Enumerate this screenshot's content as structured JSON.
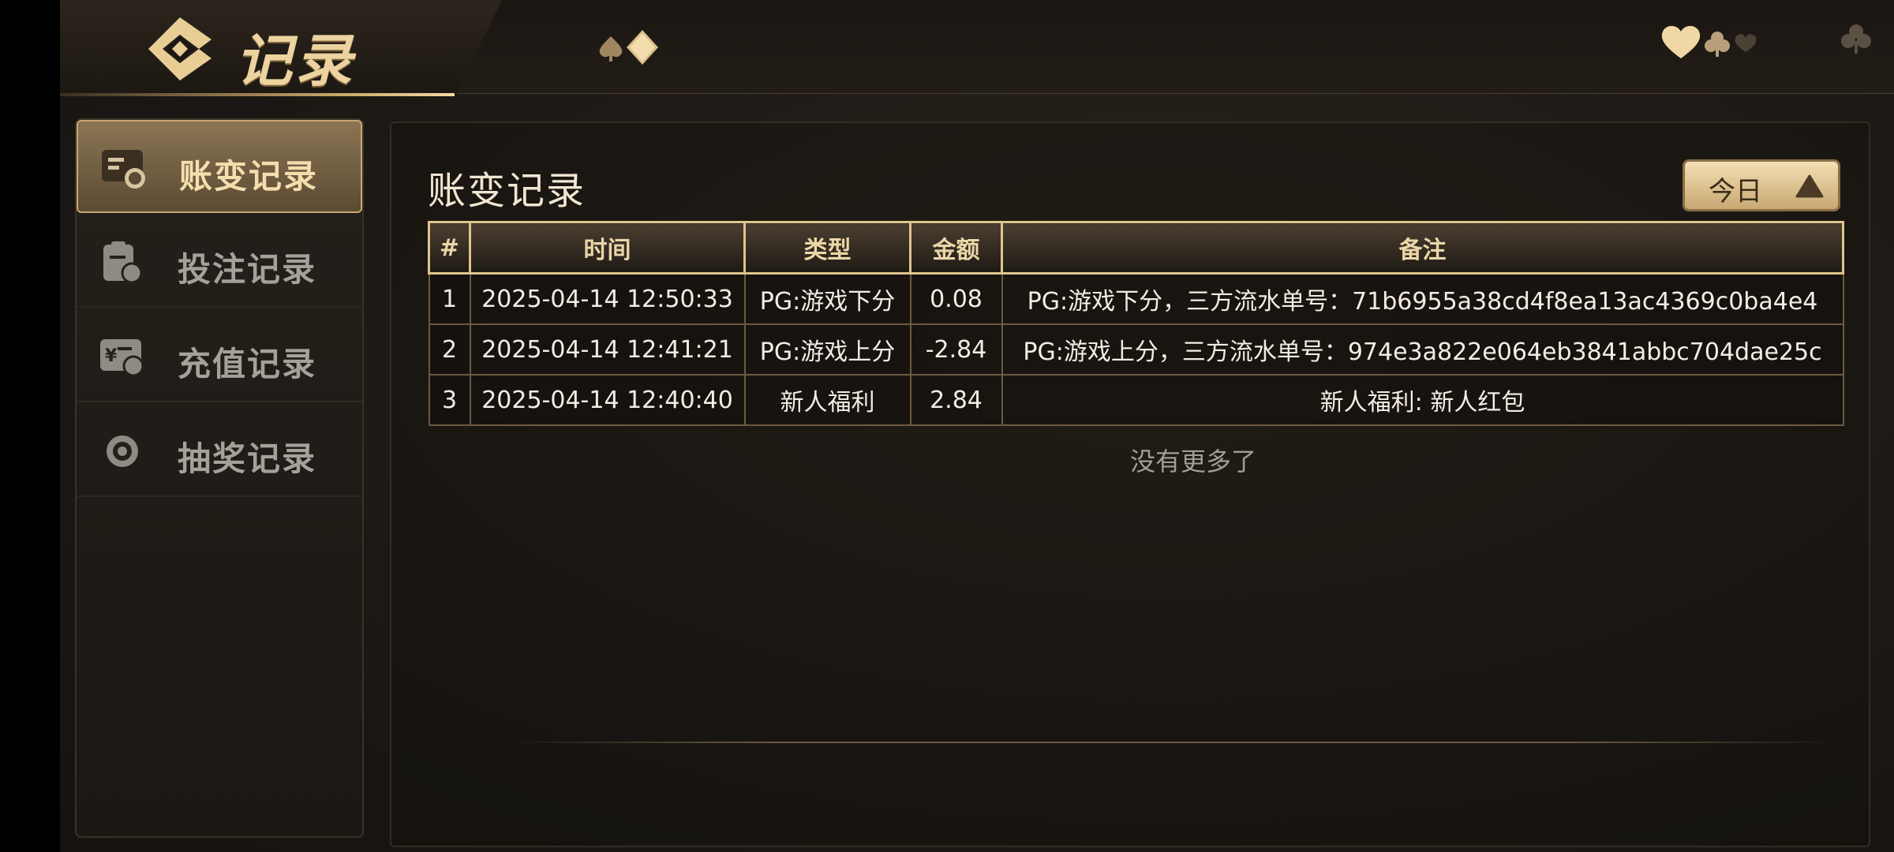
{
  "header": {
    "title": "记录",
    "colors": {
      "gold": "#ecd39f",
      "accent": "#c8a469"
    },
    "icons": [
      "back-arrow-logo-icon",
      "spade-icon",
      "diamond-icon",
      "heart-icon",
      "club-icon",
      "close-icon"
    ]
  },
  "sidebar": {
    "items": [
      {
        "label": "账变记录",
        "icon": "ledger-icon",
        "active": true
      },
      {
        "label": "投注记录",
        "icon": "bet-clipboard-icon",
        "active": false
      },
      {
        "label": "充值记录",
        "icon": "deposit-icon",
        "active": false
      },
      {
        "label": "抽奖记录",
        "icon": "lottery-wheel-icon",
        "active": false
      }
    ]
  },
  "main": {
    "title": "账变记录",
    "filter": {
      "label": "今日",
      "icon": "triangle-up-icon"
    },
    "table": {
      "headers": [
        "#",
        "时间",
        "类型",
        "金额",
        "备注"
      ],
      "rows": [
        [
          "1",
          "2025-04-14 12:50:33",
          "PG:游戏下分",
          "0.08",
          "PG:游戏下分，三方流水单号：71b6955a38cd4f8ea13ac4369c0ba4e4"
        ],
        [
          "2",
          "2025-04-14 12:41:21",
          "PG:游戏上分",
          "-2.84",
          "PG:游戏上分，三方流水单号：974e3a822e064eb3841abbc704dae25c"
        ],
        [
          "3",
          "2025-04-14 12:40:40",
          "新人福利",
          "2.84",
          "新人福利: 新人红包"
        ]
      ]
    },
    "footer_text": "没有更多了"
  }
}
